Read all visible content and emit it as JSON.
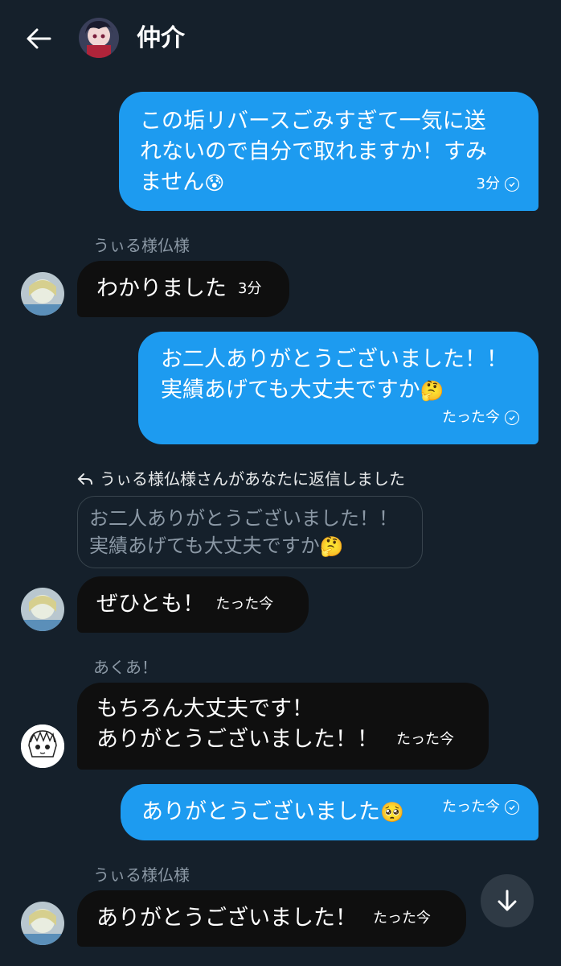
{
  "header": {
    "title": "仲介",
    "back_icon": "arrow-left-icon"
  },
  "messages": [
    {
      "direction": "out",
      "lines": [
        "この垢リバースごみすぎて一気に送",
        "れないので自分で取れますか！すみ",
        "ません"
      ],
      "emoji": "😰",
      "time": "3分",
      "status_icon": "check-circle-icon"
    },
    {
      "direction": "in",
      "sender": "うぃる様仏様",
      "text": "わかりました",
      "time": "3分"
    },
    {
      "direction": "out",
      "lines": [
        "お二人ありがとうございました！！",
        "実績あげても大丈夫ですか"
      ],
      "emoji": "🤔",
      "time": "たった今",
      "status_icon": "check-circle-icon"
    },
    {
      "direction": "in",
      "reply_note": "うぃる様仏様さんがあなたに返信しました",
      "quoted_lines": [
        "お二人ありがとうございました！！",
        "実績あげても大丈夫ですか"
      ],
      "quoted_emoji": "🤔",
      "text": "ぜひとも！",
      "time": "たった今"
    },
    {
      "direction": "in",
      "sender": "あくあ！",
      "lines": [
        "もちろん大丈夫です！",
        "ありがとうございました！！"
      ],
      "time": "たった今"
    },
    {
      "direction": "out",
      "text": "ありがとうございました",
      "emoji": "🥺",
      "time": "たった今",
      "status_icon": "check-circle-icon"
    },
    {
      "direction": "in",
      "sender": "うぃる様仏様",
      "text": "ありがとうございました！",
      "time": "たった今"
    }
  ],
  "scroll_button_icon": "arrow-down-icon",
  "colors": {
    "background": "#15202b",
    "outgoing_bubble": "#1d9bf0",
    "incoming_bubble": "#0f0f0f",
    "muted_text": "#8b98a5"
  }
}
